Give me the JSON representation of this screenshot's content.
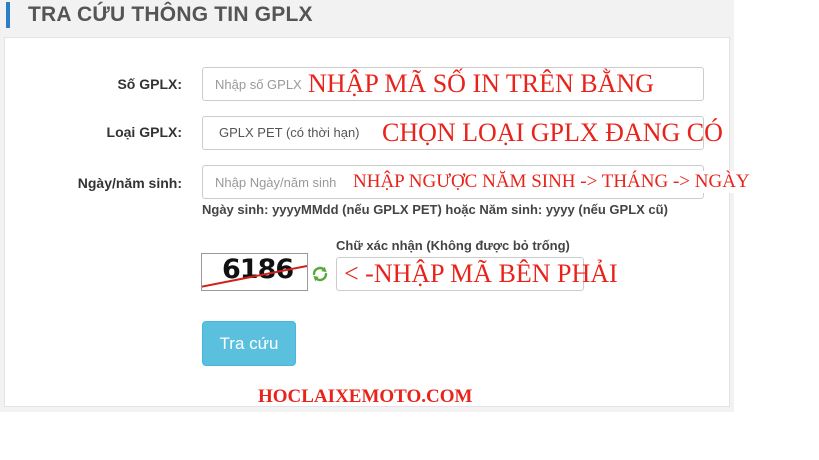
{
  "page": {
    "title": "TRA CỨU THÔNG TIN GPLX"
  },
  "form": {
    "license_number": {
      "label": "Số GPLX:",
      "placeholder": "Nhập số GPLX",
      "value": ""
    },
    "license_type": {
      "label": "Loại GPLX:",
      "selected": "GPLX PET (có thời hạn)"
    },
    "birth_date": {
      "label": "Ngày/năm sinh:",
      "placeholder": "Nhập Ngày/năm sinh",
      "hint": "Ngày sinh: yyyyMMdd (nếu GPLX PET) hoặc Năm sinh: yyyy (nếu GPLX cũ)"
    },
    "captcha": {
      "label": "Chữ xác nhận (Không được bỏ trống)",
      "code": "6186",
      "value": ""
    },
    "submit_label": "Tra cứu"
  },
  "annotations": {
    "license_number": "NHẬP MÃ SỐ IN TRÊN BẰNG",
    "license_type": "CHỌN LOẠI GPLX ĐANG CÓ",
    "birth_date": "NHẬP NGƯỢC NĂM SINH -> THÁNG -> NGÀY",
    "captcha": "< -NHẬP MÃ BÊN PHẢI",
    "watermark": "HOCLAIXEMOTO.COM"
  },
  "colors": {
    "accent": "#2a7fc6",
    "button": "#5bc0de",
    "annotation": "#e8231b"
  },
  "icons": {
    "refresh": "refresh-icon"
  }
}
